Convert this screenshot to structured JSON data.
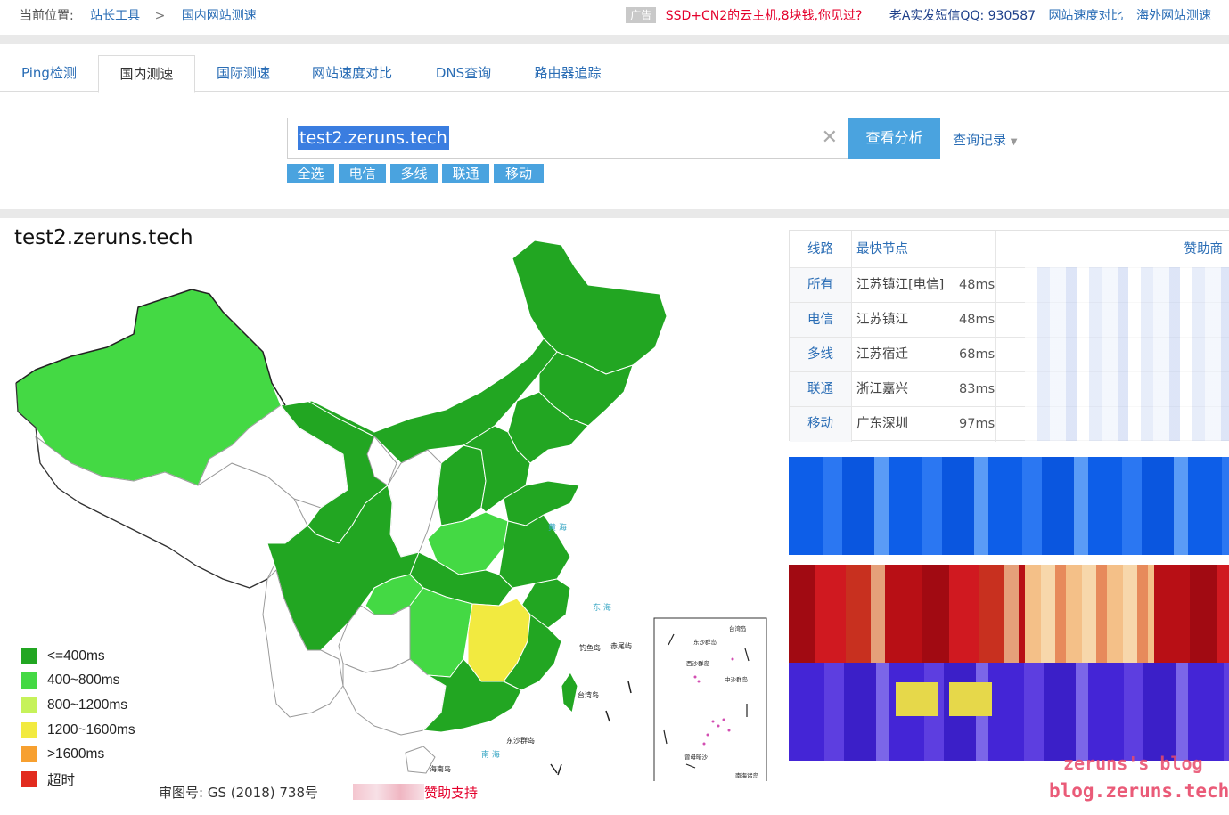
{
  "breadcrumb": {
    "prefix": "当前位置:",
    "items": [
      "站长工具",
      "国内网站测速"
    ],
    "separator": ">"
  },
  "top_ad": {
    "badge": "广告",
    "text": "SSD+CN2的云主机,8块钱,你见过?",
    "qq": "老A实发短信QQ: 930587",
    "links": [
      "网站速度对比",
      "海外网站测速"
    ]
  },
  "tabs": [
    {
      "label": "Ping检测",
      "active": false
    },
    {
      "label": "国内测速",
      "active": true
    },
    {
      "label": "国际测速",
      "active": false
    },
    {
      "label": "网站速度对比",
      "active": false
    },
    {
      "label": "DNS查询",
      "active": false
    },
    {
      "label": "路由器追踪",
      "active": false
    }
  ],
  "search": {
    "value": "test2.zeruns.tech",
    "button": "查看分析",
    "history": "查询记录"
  },
  "filters": [
    "全选",
    "电信",
    "多线",
    "联通",
    "移动"
  ],
  "result_title": "test2.zeruns.tech",
  "legend": [
    {
      "label": "<=400ms",
      "color": "#22a622"
    },
    {
      "label": "400~800ms",
      "color": "#44d944"
    },
    {
      "label": "800~1200ms",
      "color": "#c6f25a"
    },
    {
      "label": "1200~1600ms",
      "color": "#f2ea40"
    },
    {
      "label": ">1600ms",
      "color": "#f7a030"
    },
    {
      "label": "超时",
      "color": "#e22b1e"
    }
  ],
  "footer": {
    "icp": "审图号: GS (2018) 738号",
    "sponsor_suffix": "赞助支持"
  },
  "results_table": {
    "headers": {
      "line": "线路",
      "fastest": "最快节点",
      "sponsor": "赞助商"
    },
    "rows": [
      {
        "line": "所有",
        "node": "江苏镇江[电信]",
        "time": "48ms"
      },
      {
        "line": "电信",
        "node": "江苏镇江",
        "time": "48ms"
      },
      {
        "line": "多线",
        "node": "江苏宿迁",
        "time": "68ms"
      },
      {
        "line": "联通",
        "node": "浙江嘉兴",
        "time": "83ms"
      },
      {
        "line": "移动",
        "node": "广东深圳",
        "time": "97ms"
      }
    ]
  },
  "watermark": {
    "line1": "zeruns's blog",
    "line2": "blog.zeruns.tech"
  },
  "colors": {
    "accent": "#4aa3df",
    "link": "#2a6db5",
    "fast": "#22a622",
    "medium": "#44d944",
    "slow": "#f2ea40",
    "ad_red": "#e4002b"
  }
}
